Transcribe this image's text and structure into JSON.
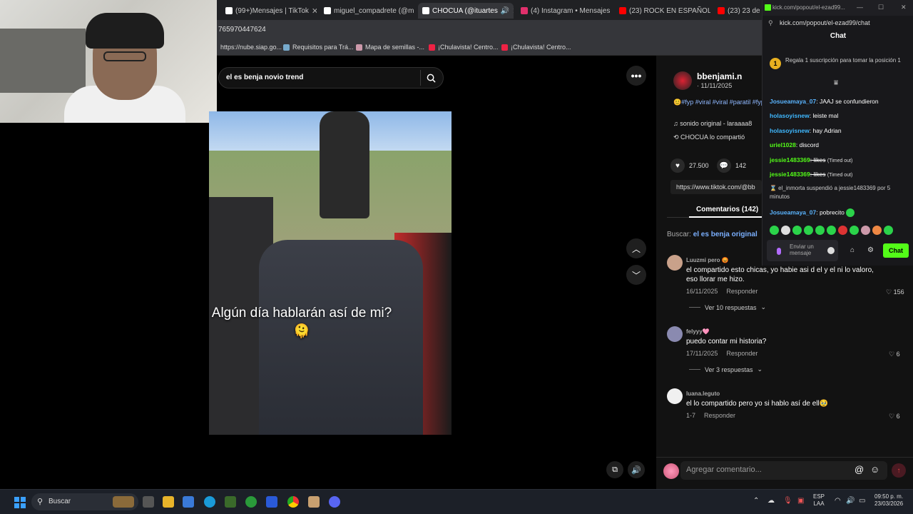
{
  "tabs": [
    {
      "label": "(99+)Mensajes | TikTok",
      "color": "#ffffff"
    },
    {
      "label": "miguel_compadrete (@m",
      "color": "#ffffff"
    },
    {
      "label": "CHOCUA (@ituartes",
      "color": "#ffffff",
      "active": true
    },
    {
      "label": "(4) Instagram • Mensajes",
      "color": "#e1306c"
    },
    {
      "label": "(23) ROCK EN ESPAÑOL",
      "color": "#ff0000"
    },
    {
      "label": "(23) 23 de m",
      "color": "#ff0000"
    }
  ],
  "url_fragment": "765970447624",
  "bookmarks": [
    "https://nube.siap.go...",
    "Requisitos para Trá...",
    "Mapa de semillas -...",
    "¡Chulavista! Centro...",
    "¡Chulavista! Centro..."
  ],
  "search": {
    "value": "el es benja novio trend"
  },
  "video": {
    "caption": "Algún día hablarán así de mi?🫠"
  },
  "author": {
    "name": "bbenjami.n",
    "date": "· 11/11/2025"
  },
  "description": {
    "hashtags": "😊#fyp #viral #viral #paratil #fypppppppppppppppppppp",
    "music": "♫ sonido original - laraaaa8",
    "shared": "CHOCUA lo compartió"
  },
  "stats": {
    "likes": "27.500",
    "comments": "142"
  },
  "link": "https://www.tiktok.com/@bb",
  "comments_tab": "Comentarios (142)",
  "search_in": {
    "prefix": "Buscar: ",
    "query": "el es benja original"
  },
  "comments": [
    {
      "user": "Luuzmi pero 😡",
      "text": "el compartido esto chicas, yo habie asi d el y el ni lo valoro, eso llorar me hizo.",
      "date": "16/11/2025",
      "reply": "Responder",
      "likes": "156",
      "replies": "Ver 10 respuestas",
      "avatar": "#c9a18a"
    },
    {
      "user": "felyyy🩷",
      "text": "puedo contar mi historia?",
      "date": "17/11/2025",
      "reply": "Responder",
      "likes": "6",
      "replies": "Ver 3 respuestas",
      "avatar": "#8a8ab0"
    },
    {
      "user": "luana.leguto",
      "text": "el lo compartido pero yo si hablo así de ell🥹",
      "date": "1-7",
      "reply": "Responder",
      "likes": "6",
      "replies": "",
      "avatar": "#f0f0f0"
    }
  ],
  "comment_placeholder": "Agregar comentario...",
  "kick": {
    "window_title": "kick.com/popout/el-ezad99...",
    "url": "kick.com/popout/el-ezad99/chat",
    "header": "Chat",
    "sub_rank": "1",
    "sub_promo": "Regala 1 suscripción para tomar la posición 1",
    "messages": [
      {
        "user": "Josueamaya_07",
        "text": ": JAAJ se confundieron",
        "color": "#5ab4ff"
      },
      {
        "user": "holasoyisnew",
        "text": ": leiste mal",
        "color": "#3fb8ff"
      },
      {
        "user": "holasoyisnew",
        "text": ": hay Adrian",
        "color": "#3fb8ff"
      },
      {
        "user": "uriel1028",
        "text": ": discord",
        "color": "#53fc18"
      },
      {
        "user": "jessie1483369",
        "text": ": likes",
        "color": "#53fc18",
        "timeout": "(Timed out)"
      },
      {
        "user": "jessie1483369",
        "text": ": likes",
        "color": "#53fc18",
        "timeout": "(Timed out)"
      },
      {
        "user": "Josueamaya_07",
        "text": ": pobrecito",
        "color": "#5ab4ff"
      }
    ],
    "system_message": "⌛ el_inmorta suspendió a jessie1483369 por 5 minutos",
    "input_placeholder": "Enviar un mensaje",
    "chat_button": "Chat"
  },
  "taskbar": {
    "search": "Buscar",
    "lang": "ESP\nLAA",
    "time": "09:50 p. m.",
    "date": "23/03/2026"
  }
}
